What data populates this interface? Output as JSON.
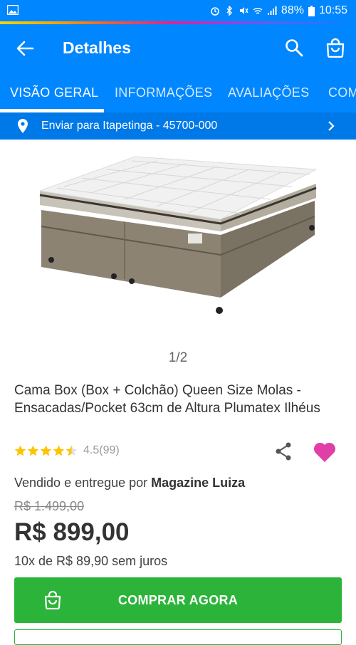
{
  "status_bar": {
    "battery": "88%",
    "time": "10:55"
  },
  "app_bar": {
    "title": "Detalhes"
  },
  "tabs": [
    {
      "label": "VISÃO GERAL"
    },
    {
      "label": "INFORMAÇÕES"
    },
    {
      "label": "AVALIAÇÕES"
    },
    {
      "label": "COM"
    }
  ],
  "shipping": {
    "text": "Enviar para Itapetinga - 45700-000"
  },
  "gallery": {
    "pager": "1/2"
  },
  "product": {
    "title": "Cama Box (Box + Colchão) Queen Size Molas - Ensacadas/Pocket 63cm de Altura Plumatex Ilhéus",
    "rating": 4.5,
    "rating_text": "4.5(99)",
    "seller_prefix": "Vendido e entregue por ",
    "seller_name": "Magazine Luiza",
    "old_price": "R$ 1.499,00",
    "price": "R$ 899,00",
    "installments": "10x de R$ 89,90 sem juros"
  },
  "buy_button": {
    "label": "COMPRAR AGORA"
  },
  "colors": {
    "primary": "#0086ff",
    "buy": "#2bb33a",
    "heart": "#e03fa8",
    "star": "#ffc400"
  }
}
